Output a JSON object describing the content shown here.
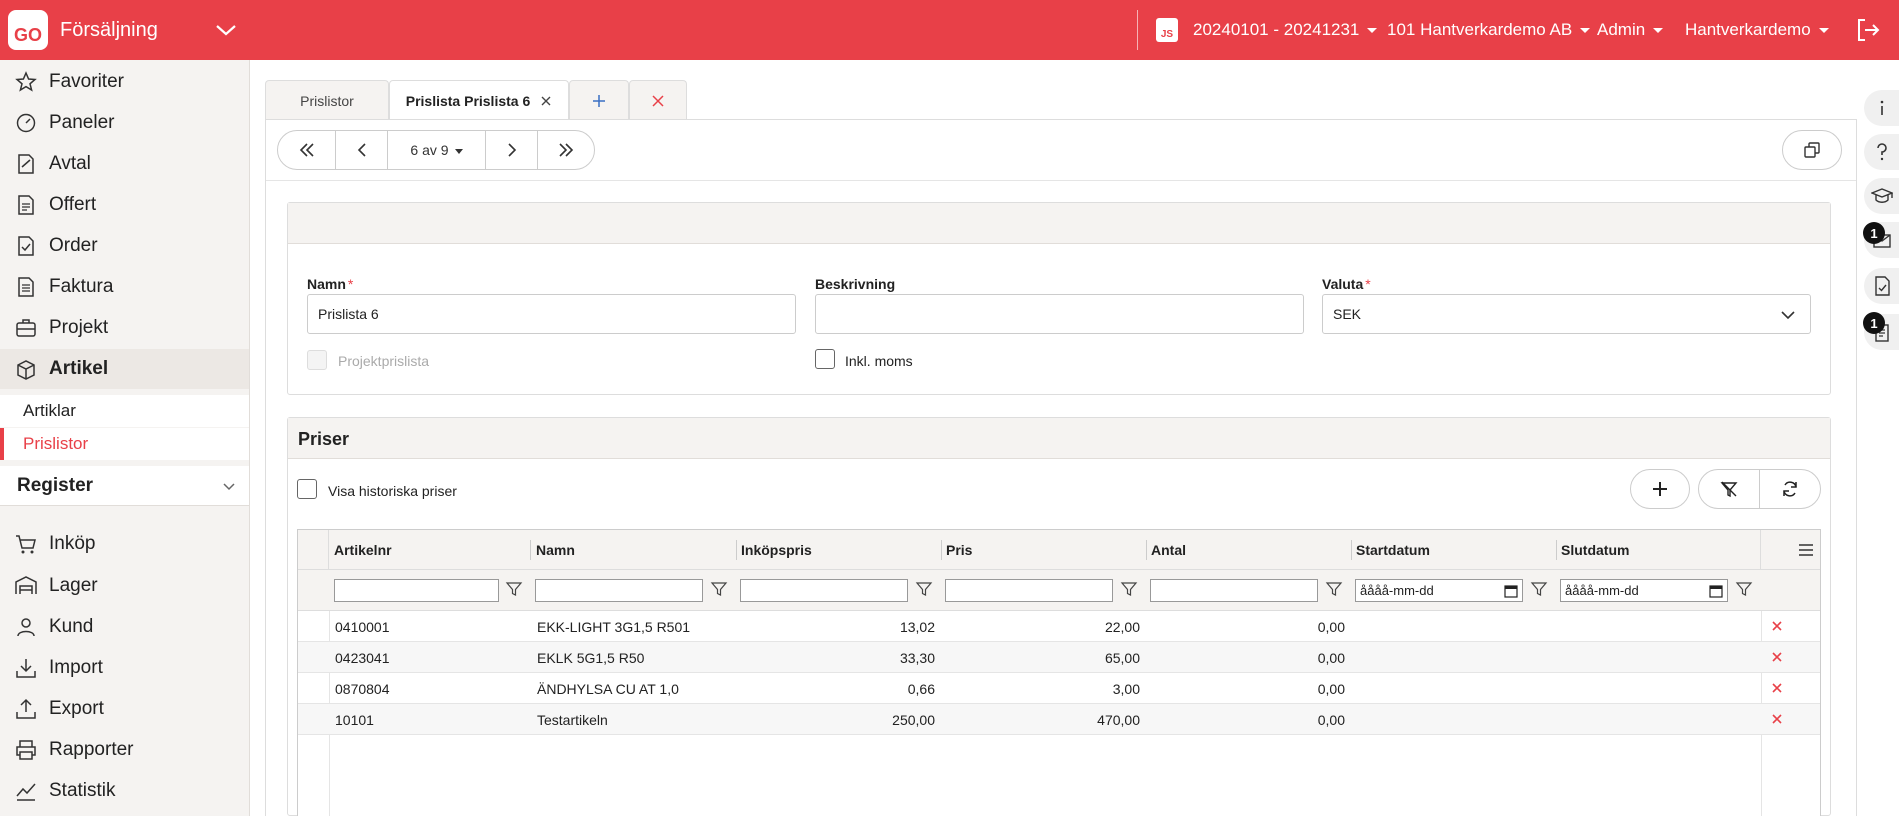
{
  "topbar": {
    "logo": "GO",
    "app_title": "Försäljning",
    "js_badge": "JS",
    "period": "20240101 - 20241231",
    "company": "101 Hantverkardemo AB",
    "role": "Admin",
    "user": "Hantverkardemo"
  },
  "sidebar": {
    "items": [
      {
        "label": "Favoriter",
        "icon": "star-icon"
      },
      {
        "label": "Paneler",
        "icon": "dashboard-icon"
      },
      {
        "label": "Avtal",
        "icon": "contract-icon"
      },
      {
        "label": "Offert",
        "icon": "document-icon"
      },
      {
        "label": "Order",
        "icon": "order-icon"
      },
      {
        "label": "Faktura",
        "icon": "invoice-icon"
      },
      {
        "label": "Projekt",
        "icon": "briefcase-icon"
      },
      {
        "label": "Artikel",
        "icon": "box-icon"
      }
    ],
    "sub_items": [
      "Artiklar",
      "Prislistor"
    ],
    "register": "Register",
    "items2": [
      {
        "label": "Inköp",
        "icon": "cart-icon"
      },
      {
        "label": "Lager",
        "icon": "warehouse-icon"
      },
      {
        "label": "Kund",
        "icon": "person-icon"
      },
      {
        "label": "Import",
        "icon": "import-icon"
      },
      {
        "label": "Export",
        "icon": "export-icon"
      },
      {
        "label": "Rapporter",
        "icon": "printer-icon"
      },
      {
        "label": "Statistik",
        "icon": "chart-icon"
      }
    ]
  },
  "tabs": {
    "list": "Prislistor",
    "active": "Prislista Prislista 6"
  },
  "pager": {
    "position": "6 av 9"
  },
  "form": {
    "name_label": "Namn",
    "name_value": "Prislista 6",
    "desc_label": "Beskrivning",
    "desc_value": "",
    "currency_label": "Valuta",
    "currency_value": "SEK",
    "project_pricelist": "Projektprislista",
    "incl_vat": "Inkl. moms",
    "required_mark": "*"
  },
  "prices": {
    "title": "Priser",
    "show_history": "Visa historiska priser",
    "columns": [
      "Artikelnr",
      "Namn",
      "Inköpspris",
      "Pris",
      "Antal",
      "Startdatum",
      "Slutdatum"
    ],
    "date_placeholder": "åååå-mm-dd",
    "rows": [
      [
        "0410001",
        "EKK-LIGHT 3G1,5 R501",
        "13,02",
        "22,00",
        "0,00",
        "",
        ""
      ],
      [
        "0423041",
        "EKLK 5G1,5 R50",
        "33,30",
        "65,00",
        "0,00",
        "",
        ""
      ],
      [
        "0870804",
        "ÄNDHYLSA CU AT 1,0",
        "0,66",
        "3,00",
        "0,00",
        "",
        ""
      ],
      [
        "10101",
        "Testartikeln",
        "250,00",
        "470,00",
        "0,00",
        "",
        ""
      ]
    ]
  },
  "rail": {
    "badge1": "1",
    "badge2": "1"
  },
  "colors": {
    "brand": "#e84048",
    "sidebar_bg": "#f5f3f1"
  }
}
